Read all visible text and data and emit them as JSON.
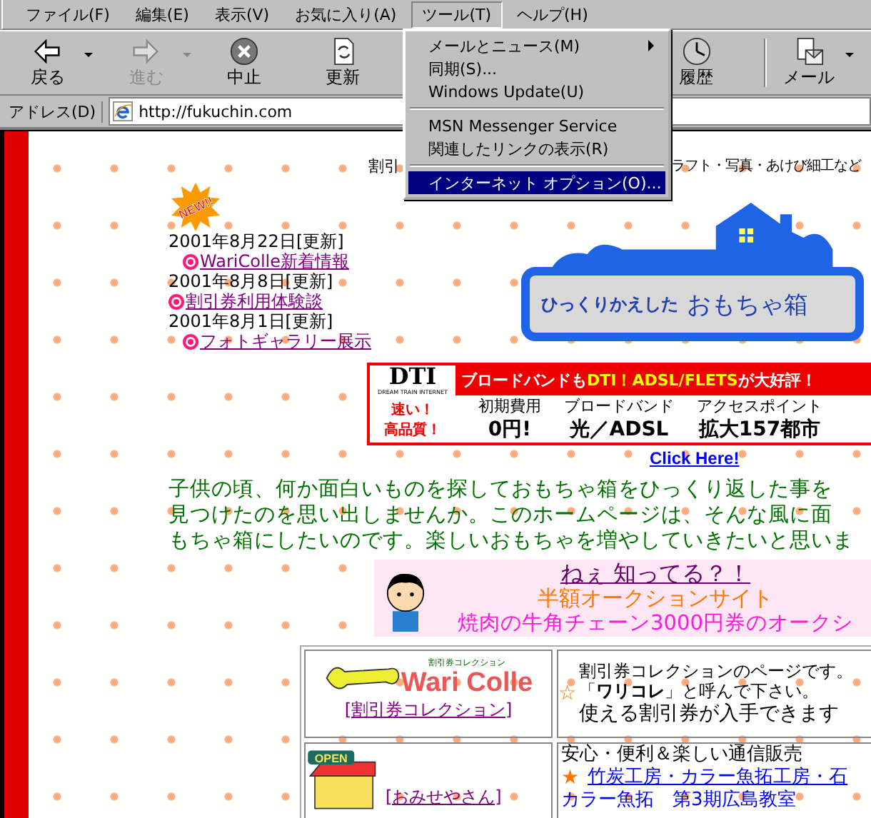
{
  "menubar": [
    {
      "label": "ファイル(F)",
      "selected": false
    },
    {
      "label": "編集(E)",
      "selected": false
    },
    {
      "label": "表示(V)",
      "selected": false
    },
    {
      "label": "お気に入り(A)",
      "selected": false
    },
    {
      "label": "ツール(T)",
      "selected": true
    },
    {
      "label": "ヘルプ(H)",
      "selected": false
    }
  ],
  "toolbar": {
    "left": [
      {
        "label": "戻る",
        "kind": "back",
        "disabled": false,
        "dropdown": true
      },
      {
        "label": "進む",
        "kind": "forward",
        "disabled": true,
        "dropdown": true
      },
      {
        "label": "中止",
        "kind": "stop",
        "disabled": false,
        "dropdown": false
      },
      {
        "label": "更新",
        "kind": "refresh",
        "disabled": false,
        "dropdown": false
      }
    ],
    "right": [
      {
        "label": "履歴",
        "kind": "history",
        "disabled": false,
        "dropdown": false
      },
      {
        "label": "メール",
        "kind": "mail",
        "disabled": false,
        "dropdown": true
      }
    ]
  },
  "address_bar": {
    "label": "アドレス(D)",
    "value": "http://fukuchin.com"
  },
  "tools_menu": [
    {
      "kind": "item",
      "label": "メールとニュース(M)",
      "submenu": true,
      "selected": false
    },
    {
      "kind": "item",
      "label": "同期(S)...",
      "submenu": false,
      "selected": false
    },
    {
      "kind": "item",
      "label": "Windows Update(U)",
      "submenu": false,
      "selected": false
    },
    {
      "kind": "separator"
    },
    {
      "kind": "item",
      "label": "MSN Messenger Service",
      "submenu": false,
      "selected": false
    },
    {
      "kind": "item",
      "label": "関連したリンクの表示(R)",
      "submenu": false,
      "selected": false
    },
    {
      "kind": "separator"
    },
    {
      "kind": "item",
      "label": "インターネット オプション(O)...",
      "submenu": false,
      "selected": true
    }
  ],
  "page": {
    "intro_left": "割引",
    "intro_right": "ラフト・写真・あけび細工など",
    "new_badge": "NEW!!",
    "news": [
      {
        "date": "2001年8月22日[更新]",
        "link": "WariColle新着情報"
      },
      {
        "date": "2001年8月8日[更新]",
        "link": "割引券利用体験談"
      },
      {
        "date": "2001年8月1日[更新]",
        "link": "フォトギャラリー展示"
      }
    ],
    "logo": {
      "left": "ひっくりかえした",
      "right": "おもちゃ箱"
    },
    "banner": {
      "brand": "DTI",
      "brand_sub": "DREAM TRAIN INTERNET",
      "headline_white": "ブロードバンドも",
      "headline_yellow": "DTI！ADSL/FLETS",
      "headline_end": "が大好評！",
      "tagline_1": "速い！",
      "tagline_2": "高品質！",
      "columns": [
        {
          "head": "初期費用",
          "value": "0円!"
        },
        {
          "head": "ブロードバンド",
          "value": "光／ADSL"
        },
        {
          "head": "アクセスポイント",
          "value": "拡大157都市"
        }
      ],
      "link": "Click Here!"
    },
    "paragraph": [
      "子供の頃、何か面白いものを探しておもちゃ箱をひっくり返した事を",
      "見つけたのを思い出しませんか。このホームページは、そんな風に面",
      "もちゃ箱にしたいのです。楽しいおもちゃを増やしていきたいと思いま"
    ],
    "notice": {
      "title": "ねぇ 知ってる？！",
      "line_1": "半額オークションサイト",
      "line_2": "焼肉の牛角チェーン3000円券のオークシ"
    },
    "sections": [
      {
        "kind": "collection",
        "logo_small": "割引券コレクション",
        "logo_big": "Wari Colle",
        "link": "[割引券コレクション]",
        "star": "☆",
        "lines": [
          "割引券コレクションのページです。",
          "「**ワリコレ**」と呼んで下さい。",
          "使える割引券が入手できます"
        ]
      },
      {
        "kind": "shop",
        "sign": "OPEN",
        "link": "[おみせやさん]",
        "star": "★",
        "lines": [
          "安心・便利＆楽しい通信販売",
          "竹炭工房・カラー魚拓工房・石",
          "カラー魚拓　第3期広島教室"
        ]
      }
    ]
  }
}
